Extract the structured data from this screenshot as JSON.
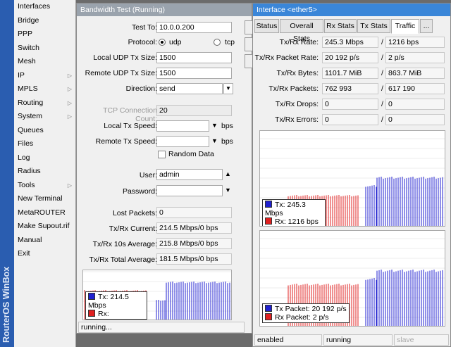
{
  "brand": "RouterOS WinBox",
  "menu": [
    {
      "label": "Interfaces",
      "sub": false
    },
    {
      "label": "Bridge",
      "sub": false
    },
    {
      "label": "PPP",
      "sub": false
    },
    {
      "label": "Switch",
      "sub": false
    },
    {
      "label": "Mesh",
      "sub": false
    },
    {
      "label": "IP",
      "sub": true
    },
    {
      "label": "MPLS",
      "sub": true
    },
    {
      "label": "Routing",
      "sub": true
    },
    {
      "label": "System",
      "sub": true
    },
    {
      "label": "Queues",
      "sub": false
    },
    {
      "label": "Files",
      "sub": false
    },
    {
      "label": "Log",
      "sub": false
    },
    {
      "label": "Radius",
      "sub": false
    },
    {
      "label": "Tools",
      "sub": true
    },
    {
      "label": "New Terminal",
      "sub": false
    },
    {
      "label": "MetaROUTER",
      "sub": false
    },
    {
      "label": "Make Supout.rif",
      "sub": false
    },
    {
      "label": "Manual",
      "sub": false
    },
    {
      "label": "Exit",
      "sub": false
    }
  ],
  "bw": {
    "title": "Bandwidth Test (Running)",
    "test_to_label": "Test To:",
    "test_to": "10.0.0.200",
    "protocol_label": "Protocol:",
    "protocol_udp": "udp",
    "protocol_tcp": "tcp",
    "local_size_label": "Local UDP Tx Size:",
    "local_size": "1500",
    "remote_size_label": "Remote UDP Tx Size:",
    "remote_size": "1500",
    "direction_label": "Direction:",
    "direction": "send",
    "conn_count_label": "TCP Connection Count:",
    "conn_count": "20",
    "local_speed_label": "Local Tx Speed:",
    "remote_speed_label": "Remote Tx Speed:",
    "bps": "bps",
    "random_data": "Random Data",
    "user_label": "User:",
    "user": "admin",
    "password_label": "Password:",
    "lost_label": "Lost Packets:",
    "lost": "0",
    "current_label": "Tx/Rx Current:",
    "current": "214.5 Mbps/0 bps",
    "avg10_label": "Tx/Rx 10s Average:",
    "avg10": "215.8 Mbps/0 bps",
    "total_label": "Tx/Rx Total Average:",
    "total": "181.5 Mbps/0 bps",
    "legend_tx_label": "Tx:",
    "legend_tx": "214.5 Mbps",
    "legend_rx_label": "Rx:",
    "legend_rx": "",
    "status": "running..."
  },
  "iface": {
    "title": "Interface <ether5>",
    "tabs": [
      "Status",
      "Overall Stats",
      "Rx Stats",
      "Tx Stats",
      "Traffic",
      "..."
    ],
    "selected_tab": "Traffic",
    "rows": [
      {
        "label": "Tx/Rx Rate:",
        "tx": "245.3 Mbps",
        "rx": "1216 bps"
      },
      {
        "label": "Tx/Rx Packet Rate:",
        "tx": "20 192 p/s",
        "rx": "2 p/s"
      },
      {
        "label": "Tx/Rx Bytes:",
        "tx": "1101.7 MiB",
        "rx": "863.7 MiB"
      },
      {
        "label": "Tx/Rx Packets:",
        "tx": "762 993",
        "rx": "617 190"
      },
      {
        "label": "Tx/Rx Drops:",
        "tx": "0",
        "rx": "0"
      },
      {
        "label": "Tx/Rx Errors:",
        "tx": "0",
        "rx": "0"
      }
    ],
    "graph1_tx_label": "Tx:",
    "graph1_tx": "245.3 Mbps",
    "graph1_rx_label": "Rx:",
    "graph1_rx": "1216 bps",
    "graph2_tx_label": "Tx Packet:",
    "graph2_tx": "20 192 p/s",
    "graph2_rx_label": "Rx Packet:",
    "graph2_rx": "2 p/s",
    "status_enabled": "enabled",
    "status_running": "running",
    "status_slave": "slave"
  },
  "colors": {
    "tx": "#3a3ad8",
    "rx": "#e03030",
    "accent": "#3a86d8",
    "brand": "#2a5db0"
  }
}
